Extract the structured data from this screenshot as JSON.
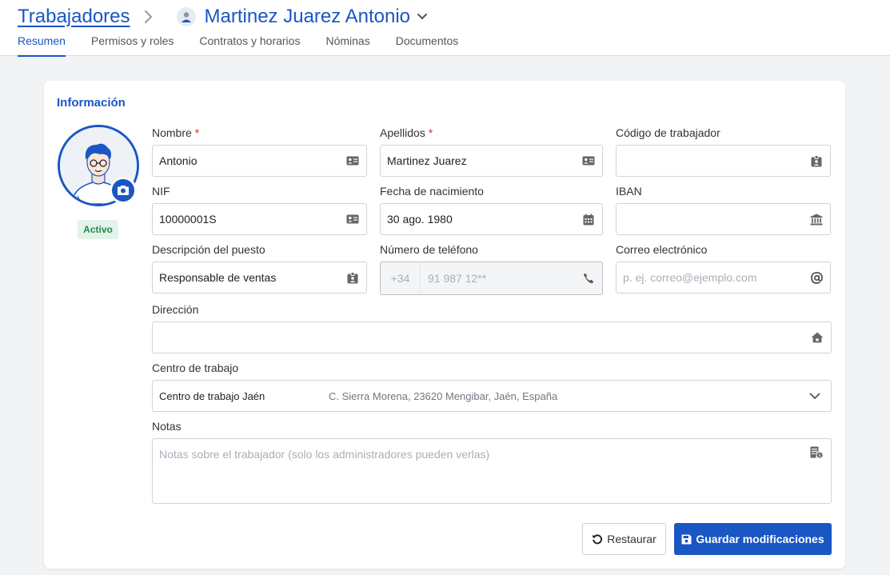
{
  "breadcrumb": {
    "root": "Trabajadores",
    "current": "Martinez Juarez Antonio"
  },
  "tabs": [
    {
      "label": "Resumen",
      "active": true
    },
    {
      "label": "Permisos y roles",
      "active": false
    },
    {
      "label": "Contratos y horarios",
      "active": false
    },
    {
      "label": "Nóminas",
      "active": false
    },
    {
      "label": "Documentos",
      "active": false
    }
  ],
  "card": {
    "title": "Información",
    "status": "Activo"
  },
  "fields": {
    "nombre": {
      "label": "Nombre",
      "required": "*",
      "value": "Antonio",
      "icon": "id-card-icon"
    },
    "apellidos": {
      "label": "Apellidos",
      "required": "*",
      "value": "Martinez Juarez",
      "icon": "id-card-icon"
    },
    "codigo": {
      "label": "Código de trabajador",
      "value": "",
      "icon": "badge-icon"
    },
    "nif": {
      "label": "NIF",
      "value": "10000001S",
      "icon": "id-card-icon"
    },
    "fecha": {
      "label": "Fecha de nacimiento",
      "value": "30 ago. 1980",
      "icon": "calendar-icon"
    },
    "iban": {
      "label": "IBAN",
      "value": "",
      "icon": "bank-icon"
    },
    "puesto": {
      "label": "Descripción del puesto",
      "value": "Responsable de ventas",
      "icon": "badge-icon"
    },
    "telefono": {
      "label": "Número de teléfono",
      "prefix": "+34",
      "placeholder": "91 987 12**",
      "icon": "phone-icon"
    },
    "correo": {
      "label": "Correo electrónico",
      "placeholder": "p. ej. correo@ejemplo.com",
      "icon": "at-icon"
    },
    "direccion": {
      "label": "Dirección",
      "value": "",
      "icon": "home-icon"
    },
    "centro": {
      "label": "Centro de trabajo",
      "name": "Centro de trabajo Jaén",
      "address": "C. Sierra Morena, 23620 Mengibar, Jaén, España"
    },
    "notas": {
      "label": "Notas",
      "placeholder": "Notas sobre el trabajador (solo los administradores pueden verlas)"
    }
  },
  "buttons": {
    "restore": "Restaurar",
    "save": "Guardar modificaciones"
  },
  "colors": {
    "accent": "#1a56c4",
    "required": "#d93025",
    "status_bg": "#e3f3ea",
    "status_text": "#1e8a4e"
  }
}
